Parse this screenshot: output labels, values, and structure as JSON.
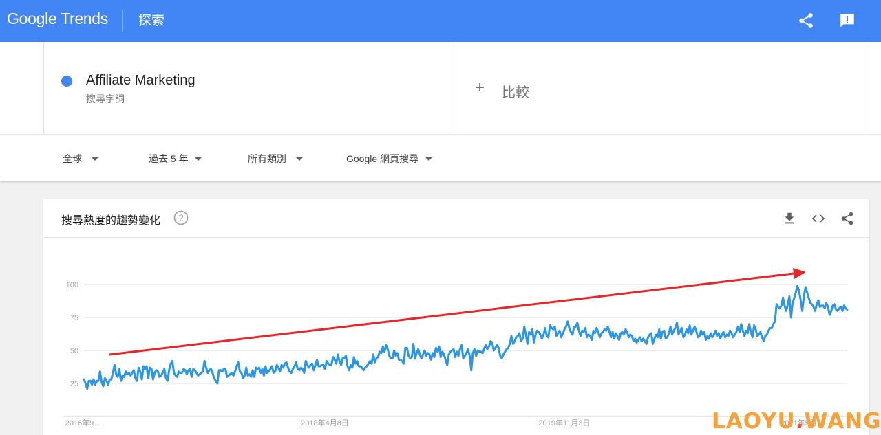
{
  "header": {
    "logo_google": "Google",
    "logo_trends": "Trends",
    "explore_label": "探索"
  },
  "term": {
    "name": "Affiliate Marketing",
    "type": "搜尋字詞",
    "color": "#4285f4"
  },
  "compare": {
    "icon": "plus-icon",
    "plus": "+",
    "label": "比較"
  },
  "filters": {
    "region": "全球",
    "time": "過去 5 年",
    "category": "所有類別",
    "search_type": "Google 網頁搜尋"
  },
  "chart_card": {
    "title": "搜尋熱度的趨勢變化",
    "icons": [
      "help-icon",
      "download-icon",
      "embed-icon",
      "share-icon"
    ]
  },
  "chart_data": {
    "type": "line",
    "title": "",
    "xlabel": "",
    "ylabel": "",
    "ylim": [
      0,
      100
    ],
    "yticks": [
      25,
      50,
      75,
      100
    ],
    "xtick_labels": [
      "2016年9…",
      "2018年4月8日",
      "2019年11月3日",
      "2021年5月…"
    ],
    "series": [
      {
        "color": "#2b96e9",
        "values": [
          28,
          25,
          21,
          27,
          27,
          24,
          28,
          24,
          27,
          27,
          34,
          26,
          23,
          29,
          27,
          24,
          28,
          28,
          33,
          39,
          32,
          30,
          36,
          27,
          31,
          30,
          34,
          32,
          33,
          31,
          33,
          35,
          29,
          27,
          37,
          34,
          28,
          38,
          36,
          38,
          29,
          37,
          36,
          28,
          33,
          35,
          34,
          30,
          31,
          33,
          36,
          29,
          27,
          35,
          40,
          42,
          33,
          31,
          30,
          34,
          33,
          33,
          36,
          35,
          32,
          35,
          36,
          30,
          36,
          35,
          33,
          31,
          32,
          33,
          34,
          42,
          37,
          33,
          35,
          36,
          33,
          29,
          27,
          25,
          35,
          35,
          34,
          36,
          36,
          30,
          31,
          32,
          33,
          31,
          34,
          38,
          41,
          34,
          33,
          29,
          31,
          37,
          31,
          32,
          30,
          35,
          30,
          37,
          36,
          37,
          33,
          36,
          31,
          38,
          33,
          34,
          36,
          38,
          33,
          34,
          39,
          37,
          34,
          39,
          37,
          40,
          41,
          37,
          34,
          33,
          36,
          38,
          41,
          36,
          35,
          37,
          36,
          33,
          42,
          39,
          37,
          39,
          40,
          35,
          39,
          43,
          38,
          38,
          39,
          39,
          36,
          42,
          40,
          39,
          39,
          45,
          43,
          40,
          47,
          42,
          39,
          44,
          44,
          46,
          38,
          35,
          39,
          37,
          45,
          40,
          42,
          38,
          38,
          37,
          35,
          37,
          38,
          40,
          42,
          40,
          47,
          41,
          44,
          45,
          49,
          48,
          53,
          49,
          54,
          51,
          46,
          44,
          44,
          50,
          46,
          48,
          43,
          43,
          42,
          40,
          52,
          52,
          46,
          44,
          45,
          55,
          44,
          48,
          51,
          47,
          44,
          47,
          50,
          46,
          48,
          47,
          43,
          48,
          45,
          52,
          49,
          53,
          45,
          49,
          47,
          43,
          39,
          47,
          49,
          50,
          51,
          45,
          49,
          46,
          51,
          54,
          44,
          46,
          48,
          51,
          46,
          35,
          48,
          51,
          46,
          50,
          49,
          49,
          48,
          51,
          54,
          51,
          53,
          57,
          56,
          50,
          52,
          54,
          52,
          46,
          44,
          47,
          49,
          51,
          52,
          55,
          61,
          55,
          57,
          60,
          61,
          63,
          57,
          59,
          68,
          62,
          55,
          64,
          62,
          66,
          56,
          62,
          65,
          64,
          62,
          59,
          62,
          67,
          61,
          60,
          69,
          67,
          66,
          68,
          61,
          63,
          65,
          60,
          63,
          66,
          68,
          72,
          67,
          64,
          62,
          68,
          68,
          71,
          65,
          61,
          65,
          64,
          67,
          60,
          62,
          61,
          58,
          65,
          63,
          67,
          64,
          60,
          63,
          64,
          66,
          65,
          68,
          64,
          60,
          64,
          59,
          63,
          61,
          58,
          63,
          64,
          62,
          66,
          64,
          60,
          62,
          61,
          57,
          59,
          56,
          58,
          60,
          57,
          59,
          57,
          55,
          60,
          62,
          63,
          55,
          59,
          62,
          60,
          66,
          59,
          64,
          65,
          59,
          60,
          63,
          68,
          62,
          65,
          67,
          71,
          62,
          65,
          67,
          60,
          62,
          66,
          63,
          69,
          62,
          65,
          68,
          65,
          60,
          61,
          65,
          62,
          64,
          58,
          61,
          59,
          63,
          60,
          62,
          65,
          61,
          63,
          59,
          62,
          64,
          60,
          62,
          61,
          65,
          63,
          60,
          62,
          64,
          68,
          64,
          70,
          65,
          61,
          65,
          63,
          70,
          64,
          60,
          69,
          66,
          61,
          62,
          64,
          60,
          57,
          61,
          62,
          65,
          67,
          67,
          70,
          72,
          85,
          83,
          82,
          84,
          90,
          84,
          80,
          85,
          91,
          75,
          86,
          90,
          94,
          99,
          95,
          88,
          80,
          91,
          98,
          94,
          90,
          86,
          85,
          83,
          80,
          85,
          88,
          83,
          84,
          84,
          82,
          86,
          83,
          77,
          80,
          84,
          85,
          81,
          80,
          82,
          83,
          80,
          84,
          82,
          81
        ]
      }
    ],
    "annotation": {
      "type": "arrow",
      "color": "#e8262a"
    }
  },
  "watermark": {
    "part1": "LAOYU",
    "dot": ".",
    "part2": "WANG"
  }
}
